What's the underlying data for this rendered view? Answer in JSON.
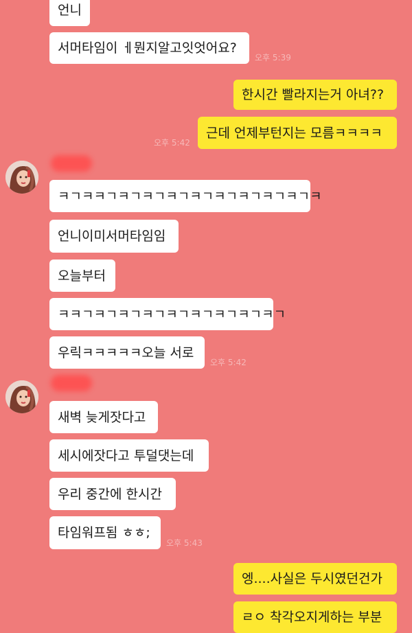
{
  "chat": {
    "colors": {
      "background": "#f07b7a",
      "incoming_bubble": "#ffffff",
      "outgoing_bubble": "#fde831"
    },
    "messages": [
      {
        "side": "in",
        "text": "언니"
      },
      {
        "side": "in",
        "text": "서머타임이 ㅔ뭔지알고잇엇어요?",
        "time": "오후 5:39"
      },
      {
        "side": "out",
        "text": "한시간 빨라지는거 아녀??"
      },
      {
        "side": "out",
        "text": "근데 언제부턴지는 모름ㅋㅋㅋㅋ",
        "time": "오후 5:42"
      },
      {
        "side": "in",
        "text": "ㅋㄱㅋㅋㄱㅋㄱㅋㄱㅋㄱㅋㄱㅋㄱㅋㄱㅋㄱㅋㄱㅋ"
      },
      {
        "side": "in",
        "text": "언니이미서머타임임"
      },
      {
        "side": "in",
        "text": "오늘부터"
      },
      {
        "side": "in",
        "text": "ㅋㅋㄱㅋㄱㅋㄱㅋㄱㅋㄱㅋㄱㅋㄱㅋㄱㅋㄱ"
      },
      {
        "side": "in",
        "text": "우릭ㅋㅋㅋㅋㅋ오늘 서로",
        "time": "오후 5:42"
      },
      {
        "side": "in",
        "text": "새벽 늦게잣다고"
      },
      {
        "side": "in",
        "text": "세시에잣다고 투덜댓는데"
      },
      {
        "side": "in",
        "text": "우리 중간에 한시간"
      },
      {
        "side": "in",
        "text": "타임워프됨 ㅎㅎ;",
        "time": "오후 5:43"
      },
      {
        "side": "out",
        "text": "엥....사실은 두시였던건가"
      },
      {
        "side": "out",
        "text": "ㄹㅇ 착각오지게하는 부분"
      }
    ]
  }
}
